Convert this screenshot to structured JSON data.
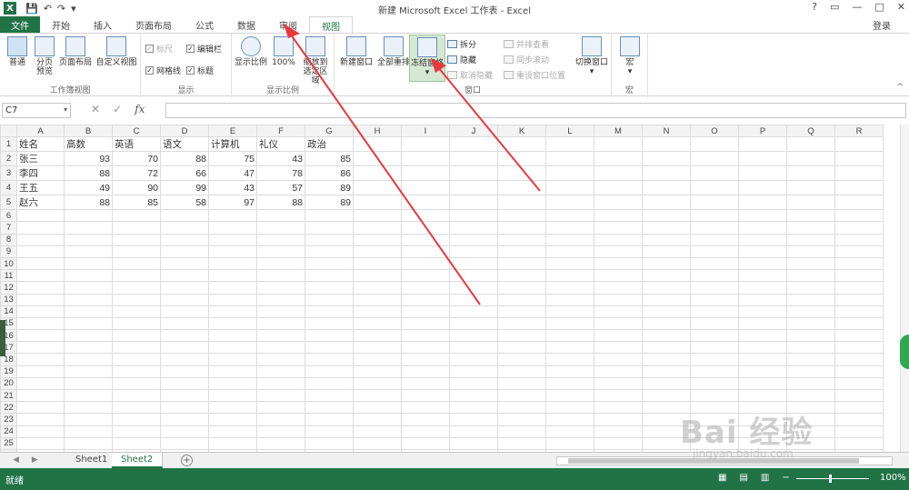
{
  "window": {
    "title": "新建 Microsoft Excel 工作表 - Excel",
    "app_icon": "X",
    "controls": [
      "?",
      "▭",
      "—",
      "□",
      "✕"
    ],
    "login": "登录"
  },
  "ribbon_tabs": [
    "文件",
    "开始",
    "插入",
    "页面布局",
    "公式",
    "数据",
    "审阅",
    "视图"
  ],
  "active_tab": "视图",
  "ribbon": {
    "workbook_views": {
      "label": "工作簿视图",
      "buttons": [
        "普通",
        "分页预览",
        "页面布局",
        "自定义视图"
      ]
    },
    "show": {
      "label": "显示",
      "ruler": "标尺",
      "formula_bar": "编辑栏",
      "gridlines": "网格线",
      "headings": "标题"
    },
    "zoom": {
      "label": "显示比例",
      "zoom": "显示比例",
      "zoom100": "100%",
      "zoom_sel": "缩放到选定区域"
    },
    "window": {
      "label": "窗口",
      "new_window": "新建窗口",
      "arrange_all": "全部重排",
      "freeze_panes": "冻结窗格",
      "split": "拆分",
      "hide": "隐藏",
      "unhide": "取消隐藏",
      "side_by_side": "并排查看",
      "sync_scroll": "同步滚动",
      "reset_pos": "重设窗口位置",
      "switch_windows": "切换窗口"
    },
    "macros": {
      "label": "宏",
      "button": "宏"
    }
  },
  "formula_bar": {
    "name_box": "C7",
    "formula": "",
    "fx": "fx"
  },
  "sheet": {
    "columns": [
      "A",
      "B",
      "C",
      "D",
      "E",
      "F",
      "G",
      "H",
      "I",
      "J",
      "K",
      "L",
      "M",
      "N",
      "O",
      "P",
      "Q",
      "R"
    ],
    "row_count": 26,
    "headers": [
      "姓名",
      "高数",
      "英语",
      "语文",
      "计算机",
      "礼仪",
      "政治"
    ],
    "rows": [
      [
        "张三",
        "93",
        "70",
        "88",
        "75",
        "43",
        "85"
      ],
      [
        "李四",
        "88",
        "72",
        "66",
        "47",
        "78",
        "86"
      ],
      [
        "王五",
        "49",
        "90",
        "99",
        "43",
        "57",
        "89"
      ],
      [
        "赵六",
        "88",
        "85",
        "58",
        "97",
        "88",
        "89"
      ]
    ]
  },
  "sheet_tabs": [
    "Sheet1",
    "Sheet2"
  ],
  "active_sheet": "Sheet2",
  "status": {
    "ready": "就绪",
    "zoom": "100%"
  },
  "watermark": {
    "main": "Bai 经验",
    "sub": "jingyan.baidu.com"
  },
  "colors": {
    "excel_green": "#217346",
    "arrow_red": "#e8383d"
  }
}
